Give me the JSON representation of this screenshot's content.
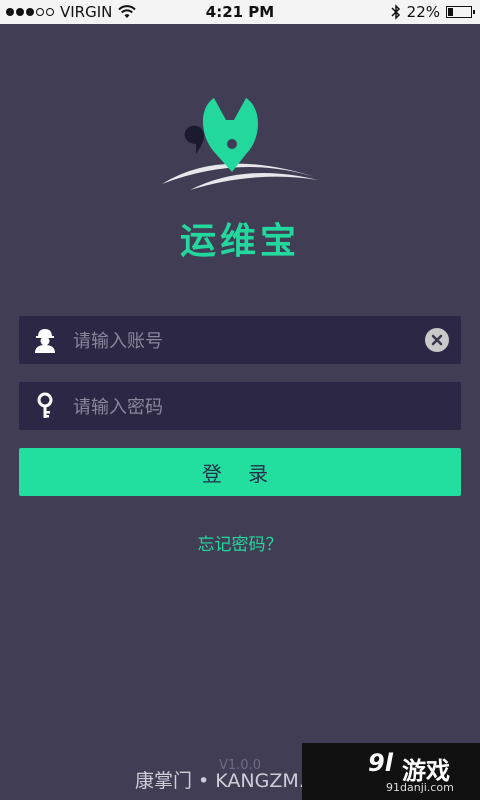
{
  "status_bar": {
    "carrier": "VIRGIN",
    "time": "4:21 PM",
    "battery_percent": "22%",
    "battery_level": 0.22
  },
  "app": {
    "name": "运维宝"
  },
  "login_form": {
    "account_placeholder": "请输入账号",
    "password_placeholder": "请输入密码",
    "login_label": "登 录",
    "forgot_label": "忘记密码？"
  },
  "footer": {
    "version": "V1.0.0"
  },
  "watermarks": {
    "left": "康掌门 • KANGZM.COM",
    "right_main": "游戏",
    "right_mark": "9l",
    "right_url": "91danji.com"
  },
  "colors": {
    "background": "#413d55",
    "accent": "#22dfa0",
    "field_bg": "#2b2744"
  },
  "icons": {
    "account": "worker-avatar-icon",
    "password": "key-icon",
    "clear": "clear-x-icon"
  }
}
